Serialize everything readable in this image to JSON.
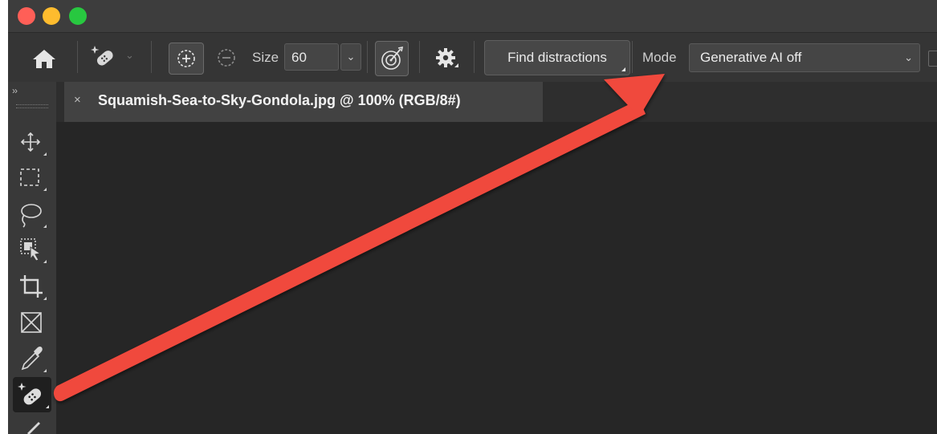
{
  "options_bar": {
    "size_label": "Size",
    "size_value": "60",
    "find_distractions_label": "Find distractions",
    "mode_label": "Mode",
    "mode_value": "Generative AI off"
  },
  "document_tab": {
    "close_glyph": "×",
    "title": "Squamish-Sea-to-Sky-Gondola.jpg @ 100% (RGB/8#)"
  },
  "panel": {
    "collapse_glyph": "››"
  },
  "tools": [
    {
      "icon": "move-icon"
    },
    {
      "icon": "marquee-icon"
    },
    {
      "icon": "lasso-icon"
    },
    {
      "icon": "object-select-icon"
    },
    {
      "icon": "crop-icon"
    },
    {
      "icon": "frame-icon"
    },
    {
      "icon": "eyedropper-icon"
    },
    {
      "icon": "remove-tool-icon",
      "active": true
    },
    {
      "icon": "brush-icon"
    }
  ],
  "colors": {
    "annotation_arrow": "#f0483e",
    "mac_red": "#ff5f57",
    "mac_yellow": "#febc2e",
    "mac_green": "#28c840"
  }
}
